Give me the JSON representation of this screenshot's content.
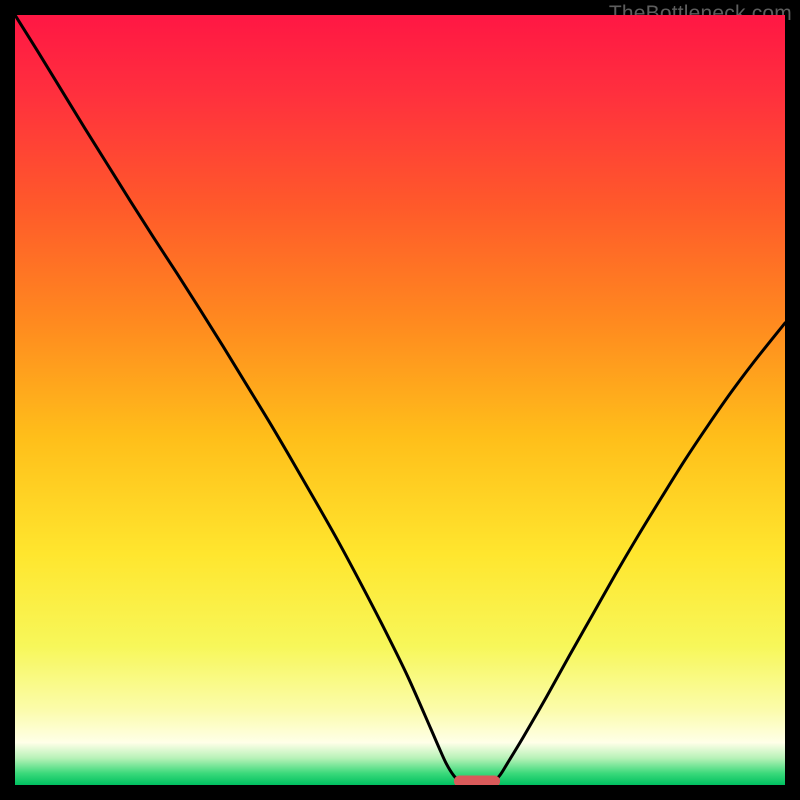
{
  "attribution": "TheBottleneck.com",
  "colors": {
    "frame": "#000000",
    "curve": "#000000",
    "marker_fill": "#d95a5a",
    "gradient_stops": [
      {
        "offset": 0.0,
        "color": "#ff1744"
      },
      {
        "offset": 0.1,
        "color": "#ff2f3e"
      },
      {
        "offset": 0.25,
        "color": "#ff5a2a"
      },
      {
        "offset": 0.4,
        "color": "#ff8a1f"
      },
      {
        "offset": 0.55,
        "color": "#ffbf1a"
      },
      {
        "offset": 0.7,
        "color": "#ffe62e"
      },
      {
        "offset": 0.82,
        "color": "#f7f75a"
      },
      {
        "offset": 0.9,
        "color": "#fbfca8"
      },
      {
        "offset": 0.945,
        "color": "#ffffe8"
      },
      {
        "offset": 0.965,
        "color": "#b8f2b8"
      },
      {
        "offset": 0.985,
        "color": "#3ad97a"
      },
      {
        "offset": 1.0,
        "color": "#00c060"
      }
    ]
  },
  "chart_data": {
    "type": "line",
    "title": "",
    "xlabel": "",
    "ylabel": "",
    "xlim": [
      0,
      100
    ],
    "ylim": [
      0,
      100
    ],
    "x": [
      0,
      3,
      6,
      9,
      12,
      15,
      18,
      21,
      24,
      27,
      30,
      33,
      36,
      39,
      42,
      45,
      48,
      51,
      54,
      55,
      56,
      57,
      58,
      59,
      60,
      61,
      62,
      63,
      64,
      66,
      69,
      72,
      75,
      78,
      81,
      84,
      87,
      90,
      93,
      96,
      100
    ],
    "values": [
      100,
      95.2,
      90.3,
      85.4,
      80.6,
      75.8,
      71.1,
      66.5,
      61.8,
      57.0,
      52.1,
      47.2,
      42.1,
      36.9,
      31.6,
      26.0,
      20.2,
      14.1,
      7.3,
      5.0,
      2.8,
      1.2,
      0.3,
      0.0,
      0.0,
      0.0,
      0.3,
      1.3,
      2.9,
      6.2,
      11.4,
      16.8,
      22.1,
      27.4,
      32.5,
      37.4,
      42.2,
      46.7,
      51.0,
      55.0,
      60.0
    ],
    "optimum_marker": {
      "x_center": 60,
      "y": 0,
      "width": 6,
      "height": 1.5
    }
  }
}
